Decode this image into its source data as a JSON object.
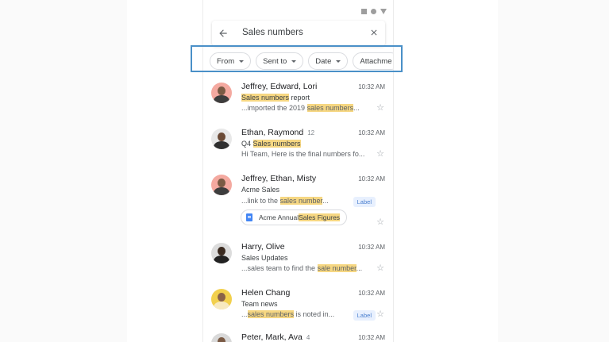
{
  "search": {
    "query": "Sales numbers"
  },
  "filters": [
    {
      "label": "From"
    },
    {
      "label": "Sent to"
    },
    {
      "label": "Date"
    },
    {
      "label": "Attachme"
    }
  ],
  "emails": [
    {
      "sender": "Jeffrey, Edward, Lori",
      "count": "",
      "time": "10:32 AM",
      "subject_hl": "Sales numbers",
      "subject_rest": " report",
      "snippet_pre": "...imported the 2019 ",
      "snippet_hl": "sales numbers",
      "snippet_post": "...",
      "avatar_bg": "#f4a9a0",
      "label": "",
      "attachment": null
    },
    {
      "sender": "Ethan, Raymond",
      "count": "12",
      "time": "10:32 AM",
      "subject_pre": "Q4 ",
      "subject_hl": "Sales numbers",
      "subject_rest": "",
      "snippet_pre": "Hi Team, Here is the final numbers fo...",
      "snippet_hl": "",
      "snippet_post": "",
      "avatar_bg": "#e8e8e8",
      "label": "",
      "attachment": null
    },
    {
      "sender": "Jeffrey, Ethan, Misty",
      "count": "",
      "time": "10:32 AM",
      "subject_pre": "Acme Sales",
      "subject_hl": "",
      "subject_rest": "",
      "snippet_pre": "...link to the ",
      "snippet_hl": "sales number",
      "snippet_post": "...",
      "avatar_bg": "#f4a9a0",
      "label": "Label",
      "attachment": {
        "pre": "Acme Annual ",
        "hl": "Sales Figures"
      }
    },
    {
      "sender": "Harry, Olive",
      "count": "",
      "time": "10:32 AM",
      "subject_pre": "Sales Updates",
      "subject_hl": "",
      "subject_rest": "",
      "snippet_pre": "...sales team to find the ",
      "snippet_hl": "sale number",
      "snippet_post": "...",
      "avatar_bg": "#dcdcdc",
      "label": "",
      "attachment": null
    },
    {
      "sender": "Helen Chang",
      "count": "",
      "time": "10:32 AM",
      "subject_pre": "Team news",
      "subject_hl": "",
      "subject_rest": "",
      "snippet_pre": "...",
      "snippet_hl": "sales numbers",
      "snippet_post": " is noted in...",
      "avatar_bg": "#f2d04d",
      "label": "Label",
      "attachment": null
    },
    {
      "sender": "Peter, Mark, Ava",
      "count": "4",
      "time": "10:32 AM",
      "subject_pre": "",
      "subject_hl": "",
      "subject_rest": "",
      "snippet_pre": "",
      "snippet_hl": "",
      "snippet_post": "",
      "avatar_bg": "#d9d9d9",
      "label": "",
      "attachment": null
    }
  ],
  "colors": {
    "highlight": "#f6d782",
    "frame": "#4a90c8",
    "label_text": "#4a7fcf"
  },
  "icons": [
    "back-arrow-icon",
    "close-icon",
    "caret-down-icon",
    "star-icon",
    "doc-icon"
  ]
}
